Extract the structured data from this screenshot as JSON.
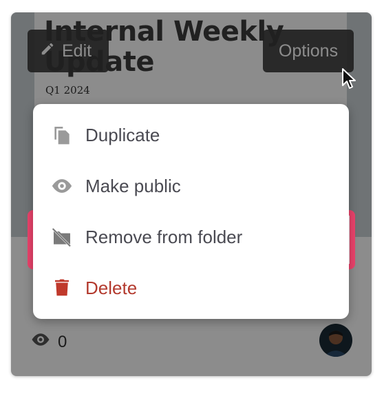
{
  "card": {
    "doc_title": "Internal Weekly Update",
    "doc_subtitle": "Q1 2024",
    "views_count": "0",
    "edit_label": "Edit",
    "options_label": "Options"
  },
  "menu": {
    "items": [
      {
        "label": "Duplicate",
        "icon": "duplicate-icon"
      },
      {
        "label": "Make public",
        "icon": "eye-icon"
      },
      {
        "label": "Remove from folder",
        "icon": "folder-off-icon"
      },
      {
        "label": "Delete",
        "icon": "trash-icon"
      }
    ]
  },
  "colors": {
    "highlight": "#ec436c",
    "delete": "#b33a2e",
    "menu_text": "#4a4a52",
    "icon_gray": "#8a8a8a"
  }
}
